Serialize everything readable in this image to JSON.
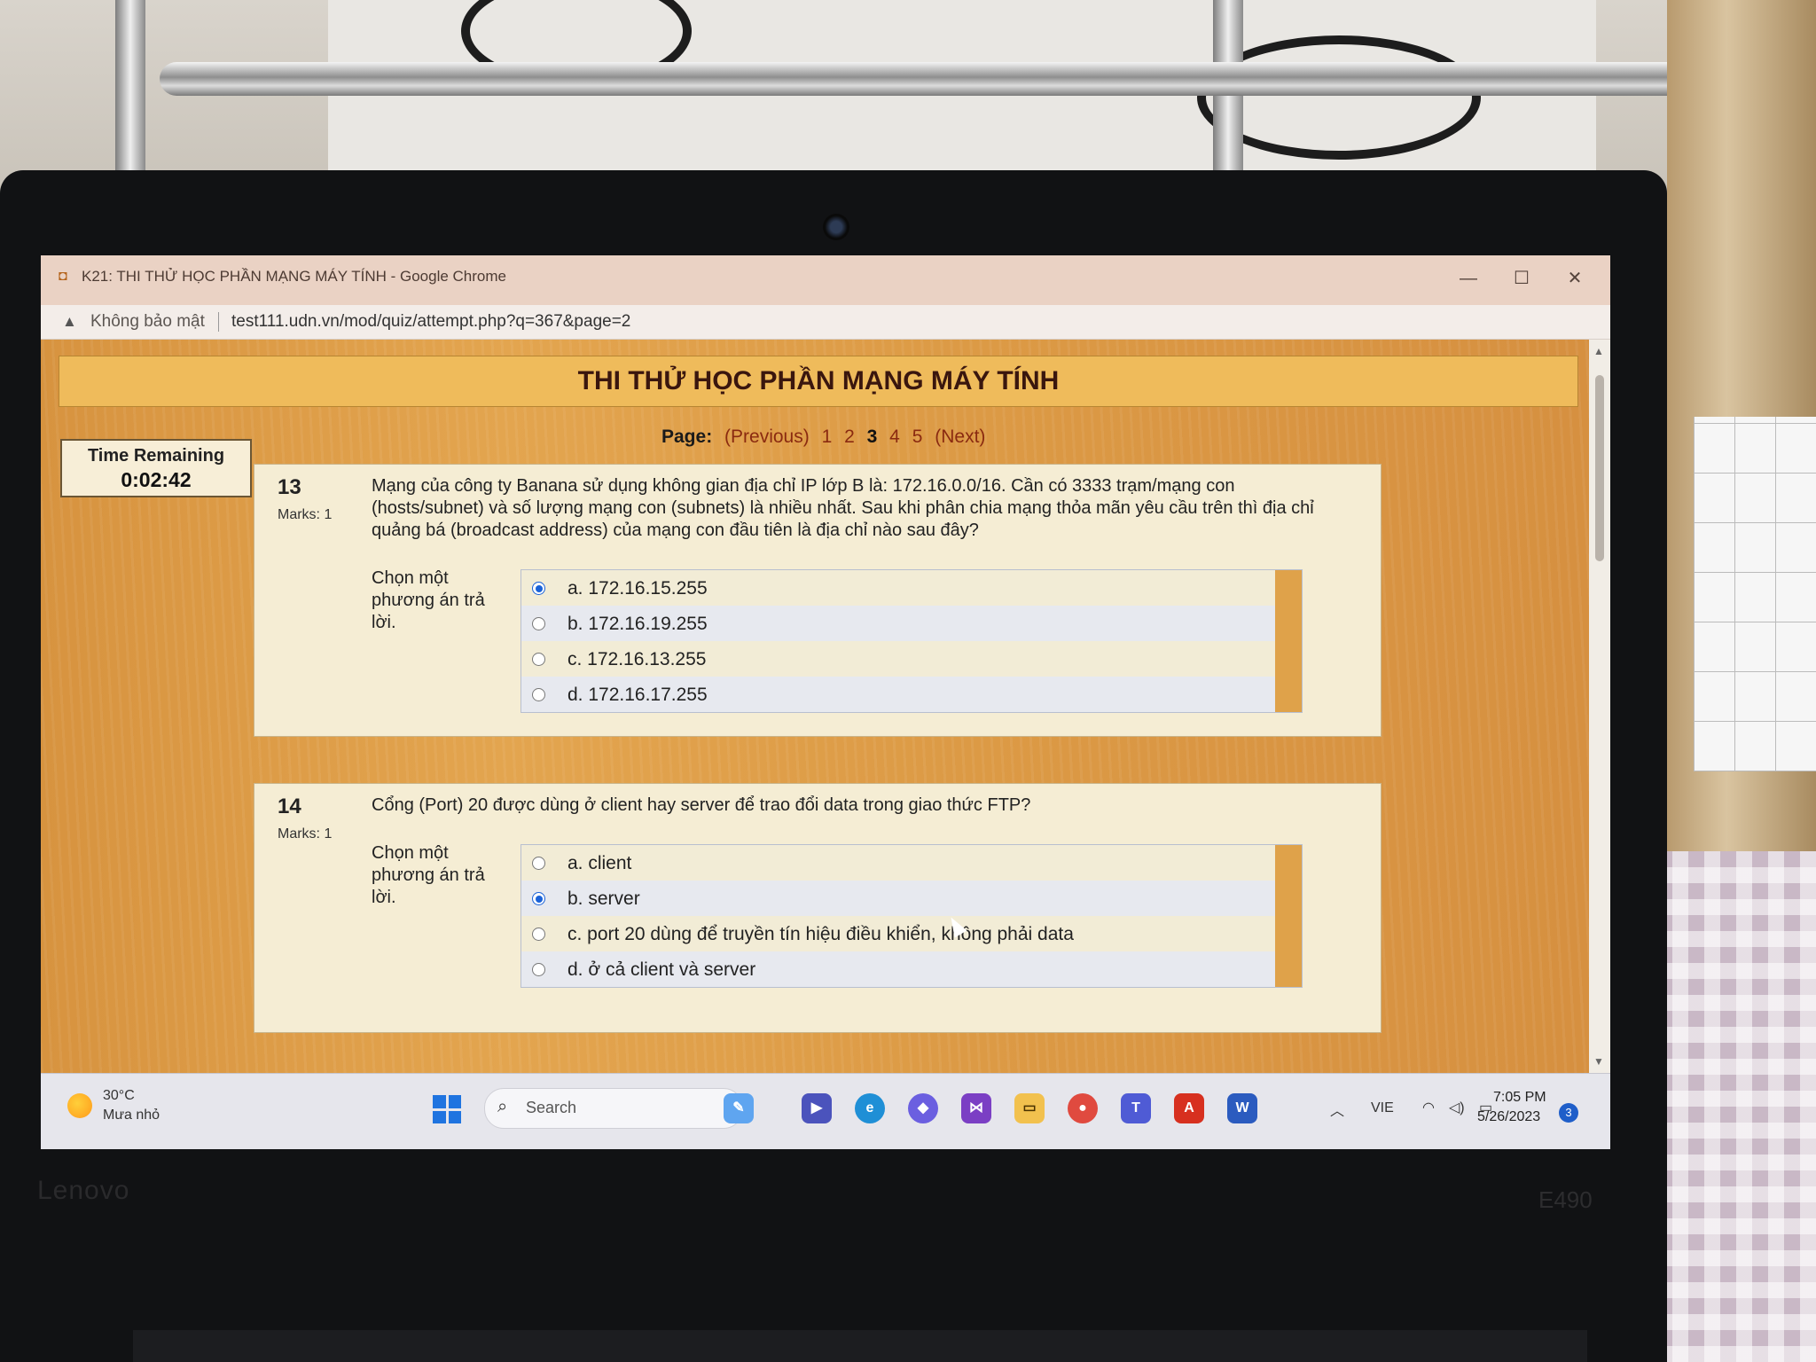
{
  "window": {
    "title": "K21: THI THỬ HỌC PHẦN MẠNG MÁY TÍNH - Google Chrome",
    "controls": {
      "minimize": "—",
      "maximize": "☐",
      "close": "✕"
    }
  },
  "address_bar": {
    "security_label": "Không bảo mật",
    "url": "test111.udn.vn/mod/quiz/attempt.php?q=367&page=2"
  },
  "quiz": {
    "title": "THI THỬ HỌC PHẦN MẠNG MÁY TÍNH",
    "pagination": {
      "label": "Page:",
      "previous": "(Previous)",
      "pages": [
        "1",
        "2",
        "3",
        "4",
        "5"
      ],
      "current": "3",
      "next": "(Next)"
    },
    "timer": {
      "label": "Time Remaining",
      "value": "0:02:42"
    },
    "questions": [
      {
        "number": "13",
        "marks": "Marks: 1",
        "text": "Mạng của công ty Banana sử dụng không gian địa chỉ IP lớp B là: 172.16.0.0/16. Cần có 3333 trạm/mạng con (hosts/subnet) và số lượng mạng con (subnets) là nhiều nhất. Sau khi phân chia mạng thỏa mãn yêu cầu trên thì địa chỉ quảng bá (broadcast address) của mạng con đầu tiên là địa chỉ nào sau đây?",
        "prompt": "Chọn một phương án trả lời.",
        "options": [
          "a. 172.16.15.255",
          "b. 172.16.19.255",
          "c. 172.16.13.255",
          "d. 172.16.17.255"
        ],
        "selected_index": 0
      },
      {
        "number": "14",
        "marks": "Marks: 1",
        "text": "Cổng (Port) 20 được dùng ở client hay server để trao đổi data trong giao thức FTP?",
        "prompt": "Chọn một phương án trả lời.",
        "options": [
          "a. client",
          "b. server",
          "c. port 20 dùng để truyền tín hiệu điều khiển, không phải data",
          "d. ở cả client và server"
        ],
        "selected_index": 1
      }
    ]
  },
  "taskbar": {
    "weather": {
      "temp": "30°C",
      "desc": "Mưa nhỏ"
    },
    "search_label": "Search",
    "language": "VIE",
    "time": "7:05 PM",
    "date": "5/26/2023",
    "notification_count": "3",
    "apps": [
      "file-explorer-widget-icon",
      "meet-icon",
      "edge-icon",
      "copilot-icon",
      "visual-studio-icon",
      "folder-icon",
      "chrome-icon",
      "teams-icon",
      "acrobat-icon",
      "word-icon"
    ]
  },
  "device": {
    "brand": "Lenovo",
    "model": "E490"
  },
  "colors": {
    "page_bg": "#dc9a45",
    "header_bg": "#efbb5b",
    "question_bg": "#f5edd4",
    "title_text": "#3a160e",
    "radio_selected": "#1a62d8"
  }
}
